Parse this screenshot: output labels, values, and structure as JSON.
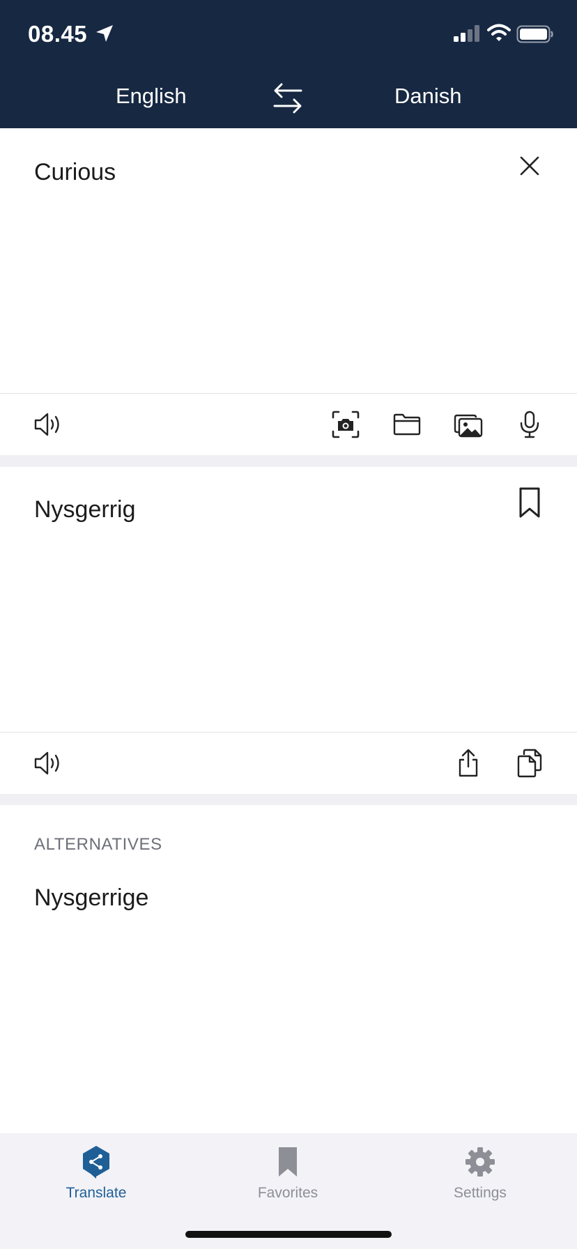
{
  "status_bar": {
    "time": "08.45",
    "icons": [
      "location-arrow-icon",
      "signal-icon",
      "wifi-icon",
      "battery-icon"
    ]
  },
  "language_bar": {
    "source_language": "English",
    "target_language": "Danish",
    "swap_icon": "swap-arrows-icon"
  },
  "input": {
    "text": "Curious",
    "clear_icon": "close-icon",
    "toolbar_icons": [
      "speaker-icon",
      "camera-scan-icon",
      "folder-icon",
      "photo-gallery-icon",
      "microphone-icon"
    ]
  },
  "output": {
    "text": "Nysgerrig",
    "bookmark_icon": "bookmark-icon",
    "toolbar_icons": [
      "speaker-icon",
      "share-icon",
      "copy-icon"
    ]
  },
  "alternatives": {
    "heading": "ALTERNATIVES",
    "items": [
      "Nysgerrige"
    ]
  },
  "tab_bar": {
    "tabs": [
      {
        "label": "Translate",
        "icon": "translate-logo-icon",
        "active": true
      },
      {
        "label": "Favorites",
        "icon": "bookmark-icon",
        "active": false
      },
      {
        "label": "Settings",
        "icon": "gear-icon",
        "active": false
      }
    ]
  },
  "colors": {
    "header_bg": "#172842",
    "accent": "#1f5f96",
    "inactive": "#8e8f96",
    "separator_bg": "#f0f0f4"
  }
}
